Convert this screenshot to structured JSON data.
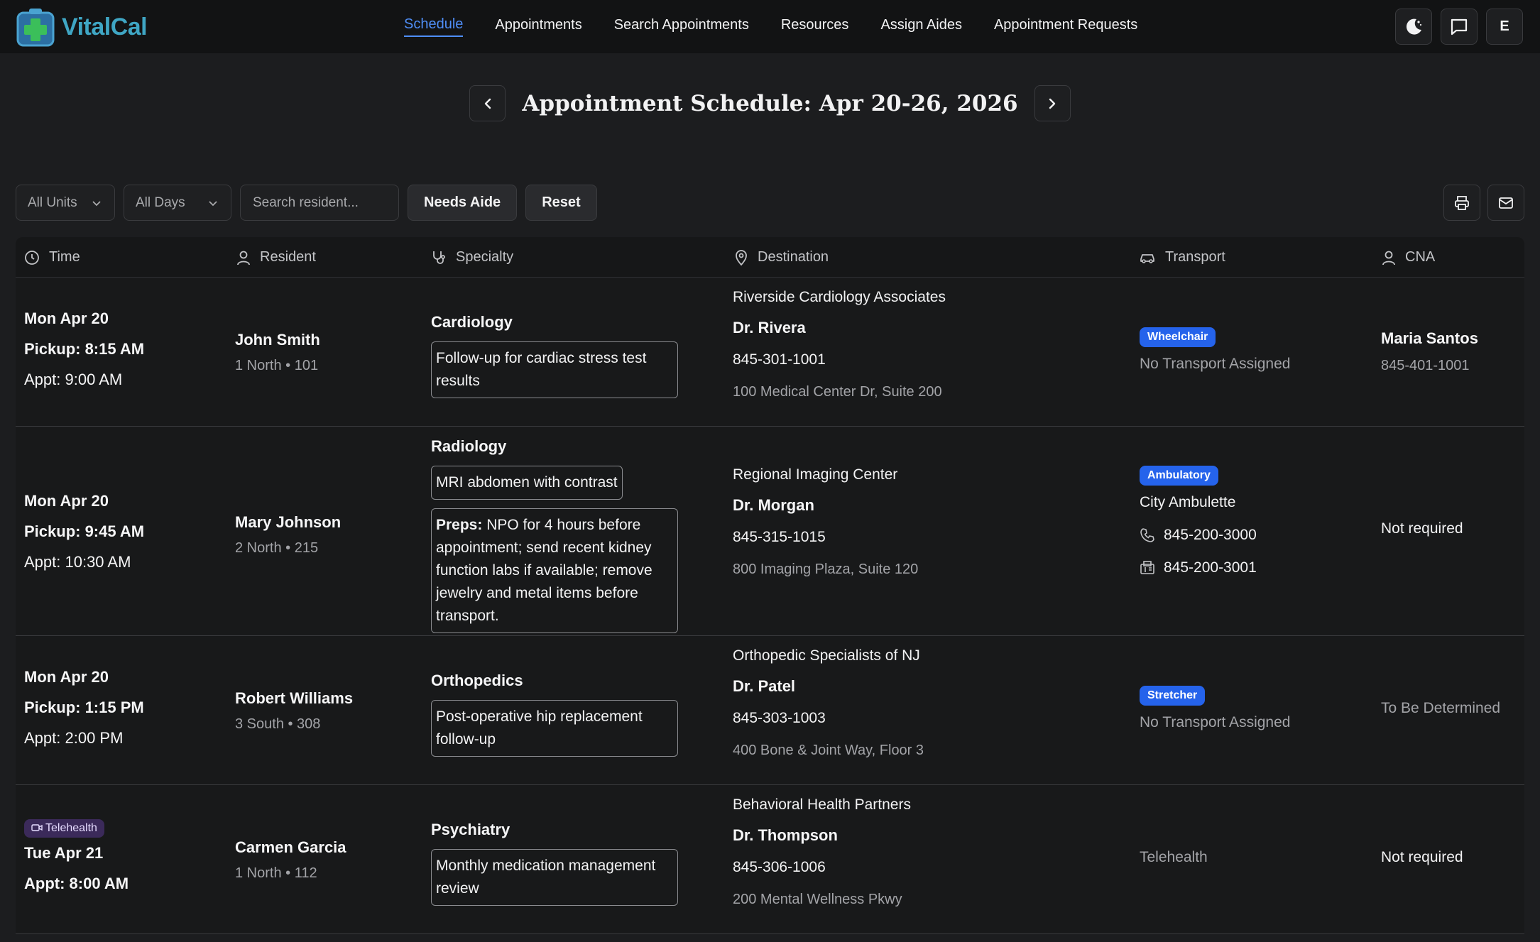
{
  "app": {
    "name": "VitalCal"
  },
  "nav": {
    "items": [
      "Schedule",
      "Appointments",
      "Search Appointments",
      "Resources",
      "Assign Aides",
      "Appointment Requests"
    ],
    "active_index": 0
  },
  "top_actions": {
    "avatar_initial": "E"
  },
  "schedule": {
    "title_prefix": "Appointment Schedule:",
    "range": "Apr 20-26, 2026"
  },
  "filters": {
    "units": "All Units",
    "days": "All Days",
    "search_placeholder": "Search resident...",
    "needs_aide": "Needs Aide",
    "reset": "Reset"
  },
  "columns": {
    "time": "Time",
    "resident": "Resident",
    "specialty": "Specialty",
    "destination": "Destination",
    "transport": "Transport",
    "cna": "CNA"
  },
  "rows": [
    {
      "day": "Mon Apr 20",
      "pickup": "Pickup: 8:15 AM",
      "appt": "Appt: 9:00 AM",
      "resident": "John Smith",
      "location": "1 North • 101",
      "specialty": "Cardiology",
      "note": "Follow-up for cardiac stress test results",
      "destination": "Riverside Cardiology Associates",
      "doctor": "Dr. Rivera",
      "phone": "845-301-1001",
      "address": "100 Medical Center Dr, Suite 200",
      "transport_badge": "Wheelchair",
      "transport_text": "No Transport Assigned",
      "cna_name": "Maria Santos",
      "cna_phone": "845-401-1001"
    },
    {
      "day": "Mon Apr 20",
      "pickup": "Pickup: 9:45 AM",
      "appt": "Appt: 10:30 AM",
      "resident": "Mary Johnson",
      "location": "2 North • 215",
      "specialty": "Radiology",
      "note": "MRI abdomen with contrast",
      "preps_label": "Preps:",
      "preps_text": " NPO for 4 hours before appointment; send recent kidney function labs if available; remove jewelry and metal items before transport.",
      "destination": "Regional Imaging Center",
      "doctor": "Dr. Morgan",
      "phone": "845-315-1015",
      "address": "800 Imaging Plaza, Suite 120",
      "transport_badge": "Ambulatory",
      "transport_company": "City Ambulette",
      "transport_phone": "845-200-3000",
      "transport_fax": "845-200-3001",
      "cna": "Not required"
    },
    {
      "day": "Mon Apr 20",
      "pickup": "Pickup: 1:15 PM",
      "appt": "Appt: 2:00 PM",
      "resident": "Robert Williams",
      "location": "3 South • 308",
      "specialty": "Orthopedics",
      "note": "Post-operative hip replacement follow-up",
      "destination": "Orthopedic Specialists of NJ",
      "doctor": "Dr. Patel",
      "phone": "845-303-1003",
      "address": "400 Bone & Joint Way, Floor 3",
      "transport_badge": "Stretcher",
      "transport_text": "No Transport Assigned",
      "cna": "To Be Determined"
    },
    {
      "badge": "Telehealth",
      "day": "Tue Apr 21",
      "appt": "Appt: 8:00 AM",
      "resident": "Carmen Garcia",
      "location": "1 North • 112",
      "specialty": "Psychiatry",
      "note": "Monthly medication management review",
      "destination": "Behavioral Health Partners",
      "doctor": "Dr. Thompson",
      "phone": "845-306-1006",
      "address": "200 Mental Wellness Pkwy",
      "transport_text": "Telehealth",
      "cna": "Not required"
    }
  ]
}
